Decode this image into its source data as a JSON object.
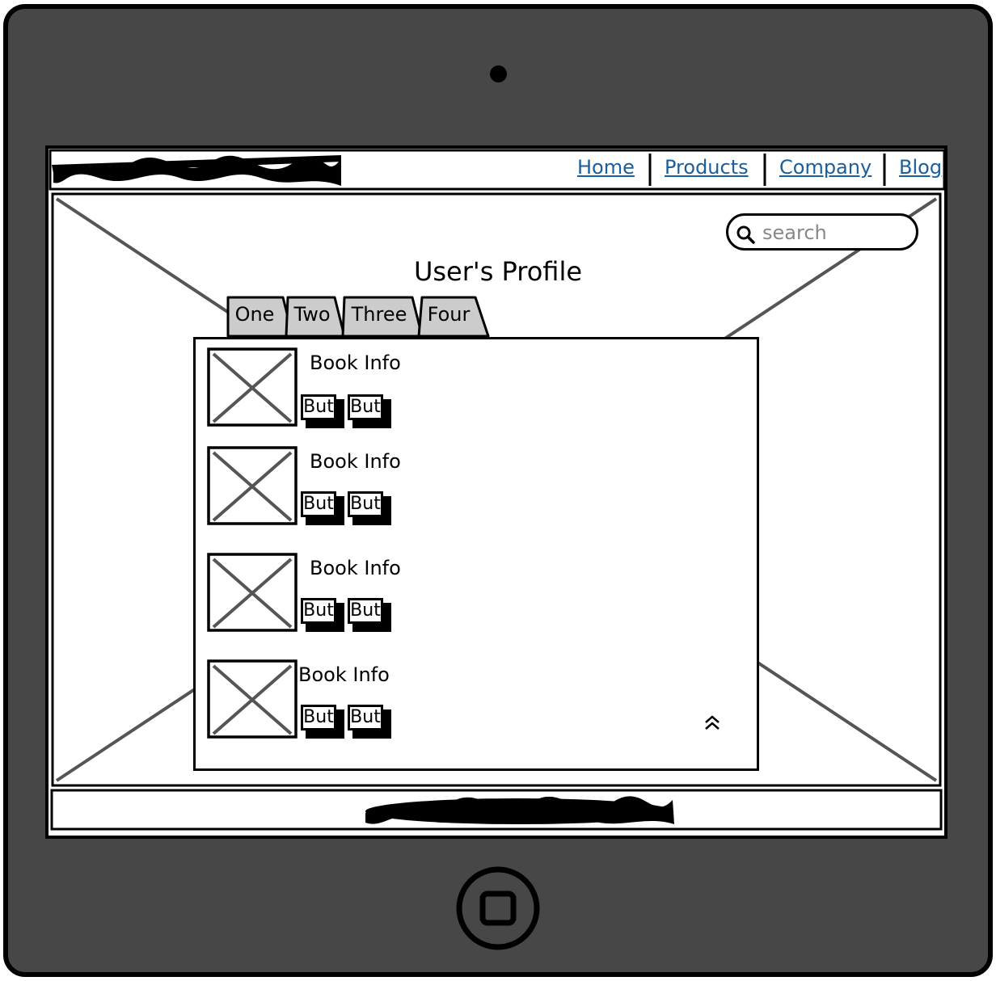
{
  "navbar": {
    "links": [
      {
        "label": "Home"
      },
      {
        "label": "Products"
      },
      {
        "label": "Company"
      },
      {
        "label": "Blog"
      }
    ]
  },
  "search": {
    "placeholder": "search"
  },
  "page": {
    "title": "User's Profile"
  },
  "tabs": [
    {
      "label": "One"
    },
    {
      "label": "Two"
    },
    {
      "label": "Three"
    },
    {
      "label": "Four"
    }
  ],
  "books": [
    {
      "info": "Book Info",
      "button1": "But",
      "button2": "But"
    },
    {
      "info": "Book Info",
      "button1": "But",
      "button2": "But"
    },
    {
      "info": "Book Info",
      "button1": "But",
      "button2": "But"
    },
    {
      "info": "Book Info",
      "button1": "But",
      "button2": "But"
    }
  ],
  "icons": {
    "search": "search-icon",
    "scroll_top": "double-chevron-up-icon",
    "camera": "camera-icon",
    "home": "home-button-icon"
  },
  "colors": {
    "frame": "#474747",
    "link": "#1a5e9c",
    "tab": "#cccccc",
    "placeholder_x": "#555555"
  }
}
